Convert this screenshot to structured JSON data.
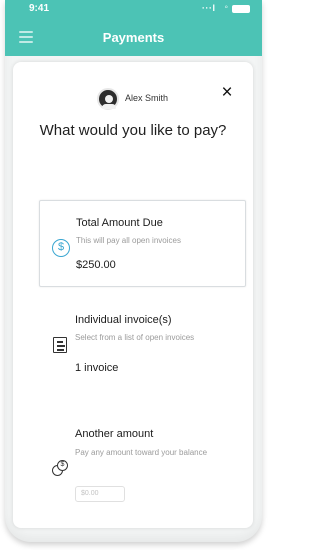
{
  "status_bar": {
    "time": "9:41",
    "signal": "∙∙∙l",
    "wifi": "◦"
  },
  "header": {
    "title": "Payments"
  },
  "modal": {
    "user_name": "Alex Smith",
    "close_label": "×",
    "question": "What would you like to pay?",
    "options": [
      {
        "title": "Total Amount Due",
        "description": "This will pay all open invoices",
        "value": "$250.00",
        "icon": "dollar-circle-icon",
        "selected": true
      },
      {
        "title": "Individual invoice(s)",
        "description": "Select from a list of open invoices",
        "value": "1 invoice",
        "icon": "document-icon",
        "selected": false
      },
      {
        "title": "Another amount",
        "description": "Pay any amount toward your balance",
        "value_placeholder": "$0.00",
        "icon": "coins-icon",
        "selected": false
      }
    ]
  },
  "colors": {
    "brand": "#4cc3b5",
    "accent": "#39a6d1",
    "text_primary": "#1c1c1c",
    "text_muted": "#9b9b9b"
  }
}
